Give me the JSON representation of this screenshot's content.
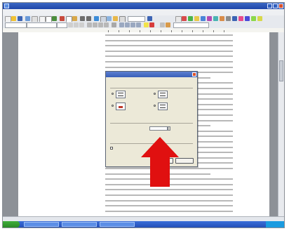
{
  "window": {
    "title": ""
  },
  "menu": {
    "items": [
      "",
      "",
      "",
      "",
      "",
      "",
      "",
      "",
      "",
      "",
      ""
    ]
  },
  "toolbar1": {
    "zoom": ""
  },
  "toolbar2": {
    "style": "",
    "font": "",
    "size": ""
  },
  "dialog": {
    "title": "",
    "intro": "",
    "group1": "",
    "group2": "",
    "options": [
      "",
      "",
      "",
      ""
    ],
    "field_value": "",
    "checkbox_label": "",
    "ok_label": "",
    "cancel_label": ""
  },
  "status": {
    "page": "",
    "section": "",
    "position": "",
    "line": "",
    "column": "",
    "language": ""
  },
  "taskbar": {
    "start": "",
    "tasks": [
      "",
      "",
      ""
    ],
    "clock": ""
  },
  "annotation": {
    "arrow_color": "#e01010"
  },
  "colors": {
    "titlebar": "#2b52b4",
    "desktop": "#8d9197",
    "taskbar": "#2c5cc8",
    "accent": "#e01010"
  }
}
